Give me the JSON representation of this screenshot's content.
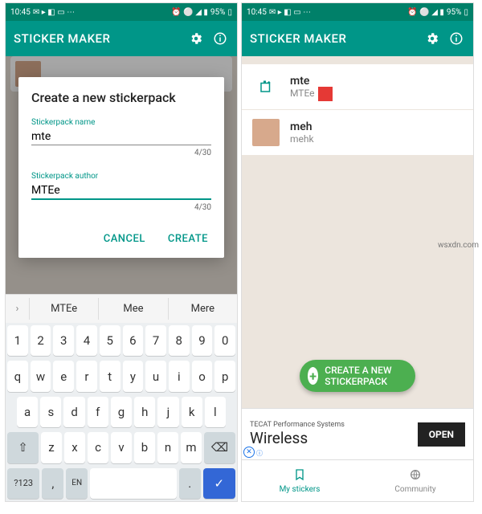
{
  "status": {
    "time": "10:45",
    "battery": "95%"
  },
  "appbar": {
    "title": "STICKER MAKER"
  },
  "dialog": {
    "title": "Create a new stickerpack",
    "name_label": "Stickerpack name",
    "name_value": "mte",
    "name_count": "4/30",
    "author_label": "Stickerpack author",
    "author_value": "MTEe",
    "author_count": "4/30",
    "cancel": "CANCEL",
    "create": "CREATE"
  },
  "suggestions": [
    "MTEe",
    "Mee",
    "Mere"
  ],
  "keyboard": {
    "row1": [
      "1",
      "2",
      "3",
      "4",
      "5",
      "6",
      "7",
      "8",
      "9",
      "0"
    ],
    "row2": [
      "q",
      "w",
      "e",
      "r",
      "t",
      "y",
      "u",
      "i",
      "o",
      "p"
    ],
    "row3": [
      "a",
      "s",
      "d",
      "f",
      "g",
      "h",
      "j",
      "k",
      "l"
    ],
    "row4_shift": "⇧",
    "row4": [
      "z",
      "x",
      "c",
      "v",
      "b",
      "n",
      "m"
    ],
    "row4_back": "⌫",
    "row5_sym": "?123",
    "row5_comma": ",",
    "row5_lang": "EN",
    "row5_dot": ".",
    "row5_enter": "✓"
  },
  "packs": [
    {
      "title": "mte",
      "author": "MTEe",
      "icon": "add"
    },
    {
      "title": "meh",
      "author": "mehk",
      "icon": "img"
    }
  ],
  "fab": "CREATE A NEW STICKERPACK",
  "ad": {
    "top": "TECAT Performance Systems",
    "bottom": "Wireless",
    "cta": "OPEN"
  },
  "bottomnav": {
    "mine": "My stickers",
    "community": "Community"
  },
  "watermark": "wsxdn.com"
}
